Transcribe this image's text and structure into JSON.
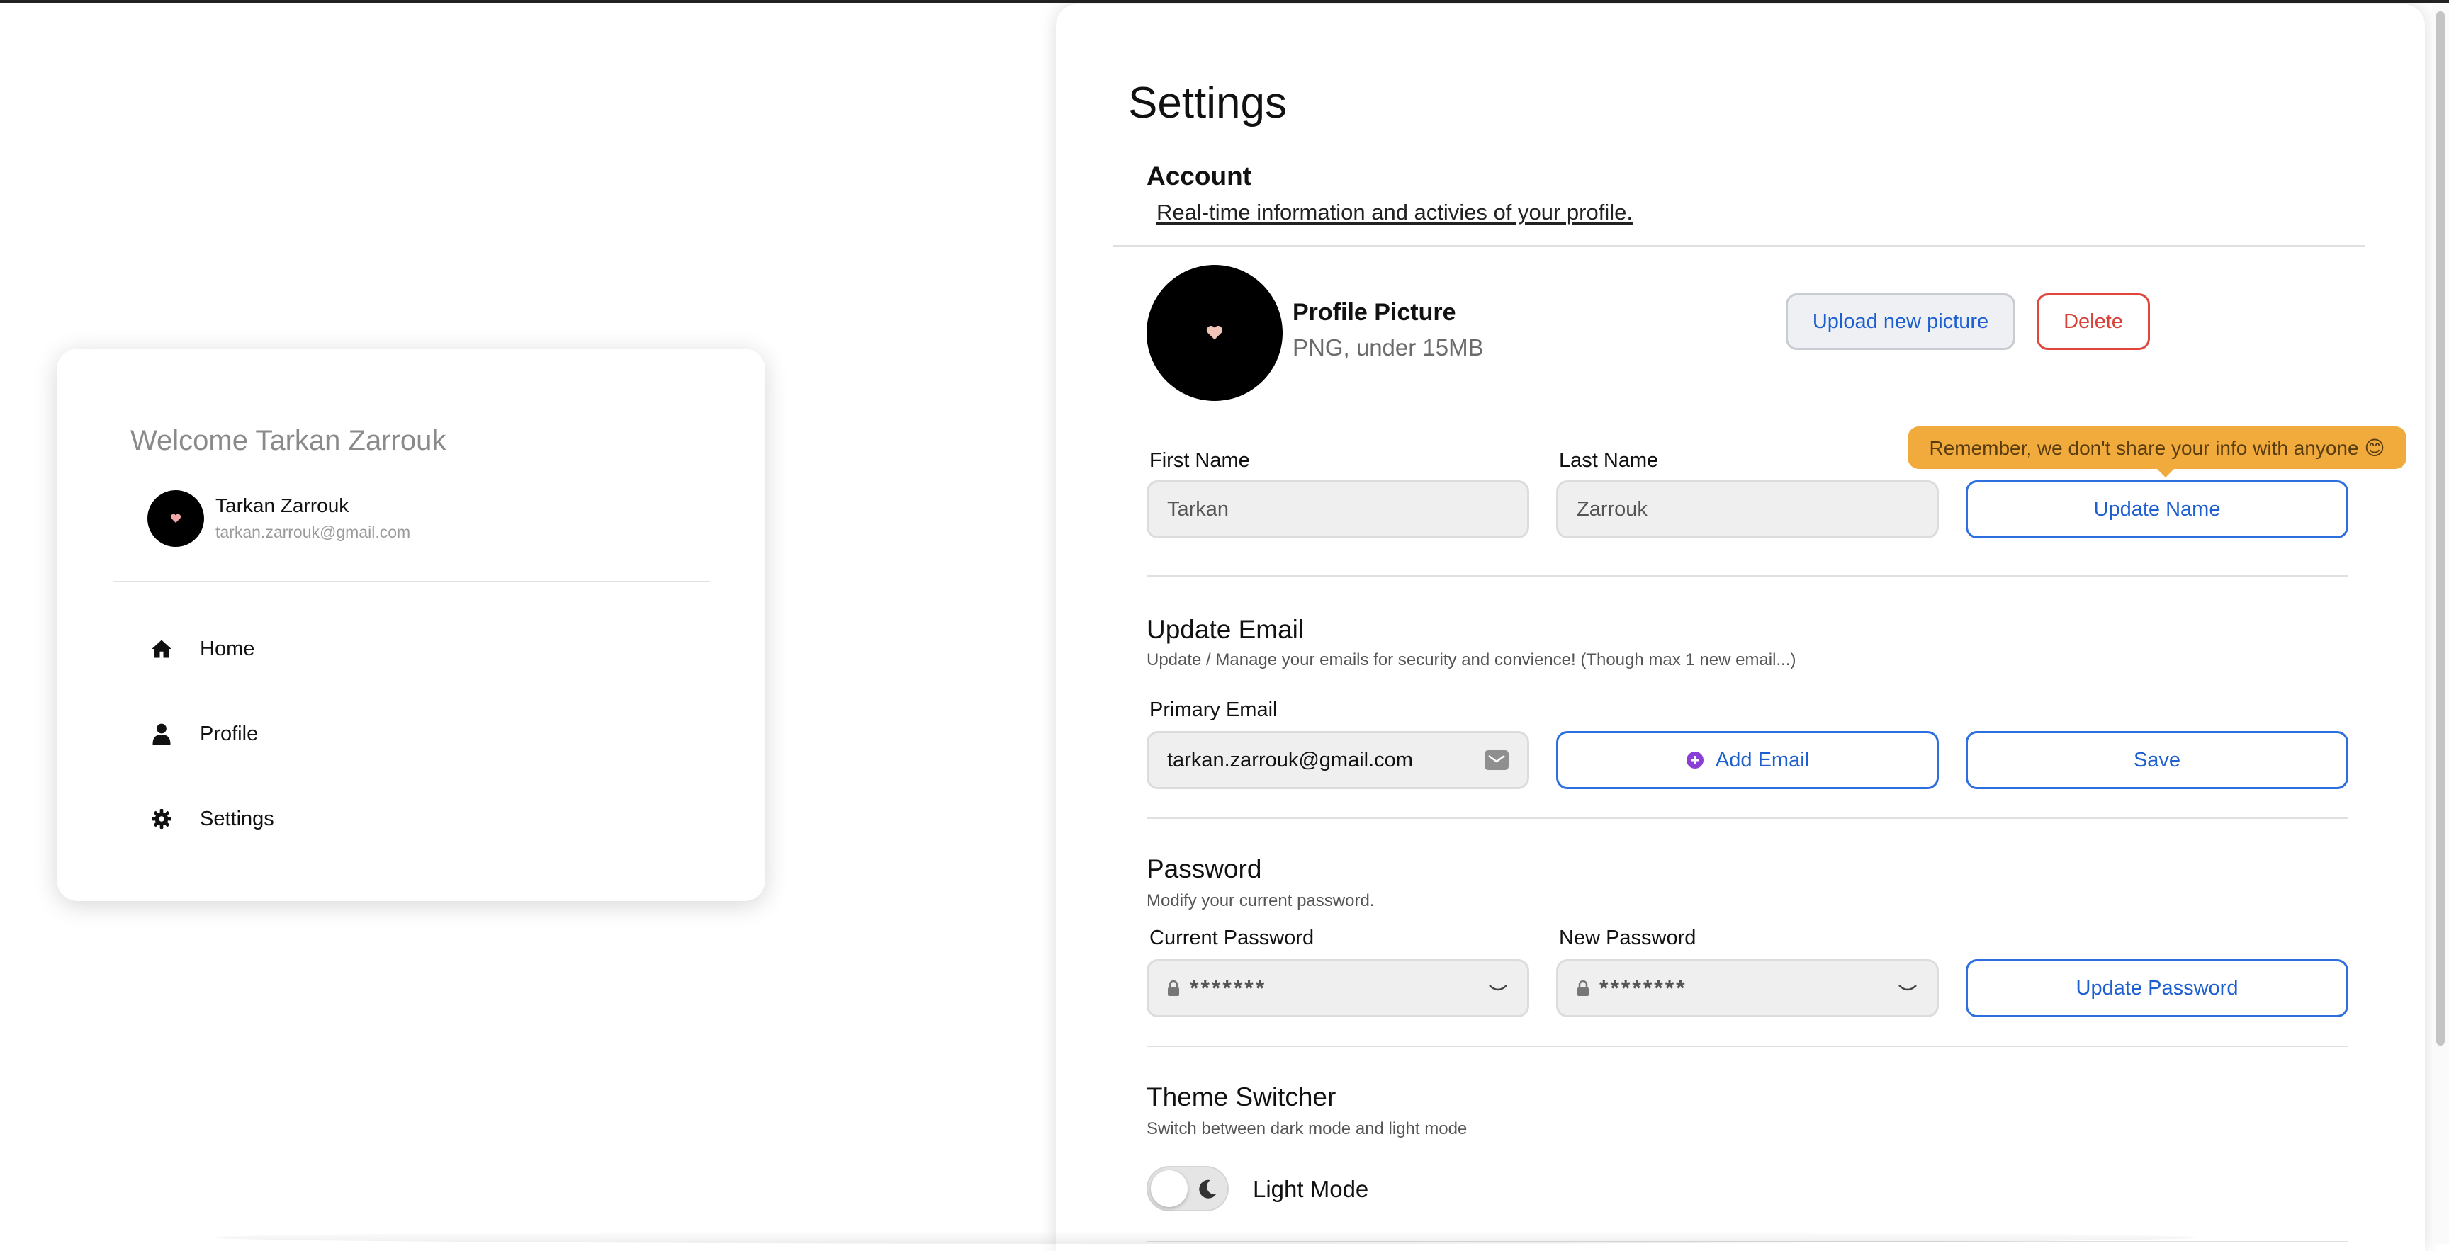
{
  "sidebar": {
    "welcome": "Welcome Tarkan Zarrouk",
    "user_name": "Tarkan Zarrouk",
    "user_email": "tarkan.zarrouk@gmail.com",
    "nav": [
      {
        "label": "Home",
        "icon": "home-icon"
      },
      {
        "label": "Profile",
        "icon": "user-icon"
      },
      {
        "label": "Settings",
        "icon": "gear-icon"
      }
    ]
  },
  "settings": {
    "title": "Settings",
    "account": {
      "title": "Account",
      "subtitle": "Real-time information and activies of your profile."
    },
    "profile_picture": {
      "title": "Profile Picture",
      "subtitle": "PNG, under 15MB",
      "upload_label": "Upload new picture",
      "delete_label": "Delete"
    },
    "name": {
      "tooltip": "Remember, we don't share your info with anyone 😊",
      "first_label": "First Name",
      "first_value": "Tarkan",
      "last_label": "Last Name",
      "last_value": "Zarrouk",
      "update_label": "Update Name"
    },
    "email": {
      "title": "Update Email",
      "subtitle": "Update / Manage your emails for security and convience! (Though max 1 new email...)",
      "primary_label": "Primary Email",
      "primary_value": "tarkan.zarrouk@gmail.com",
      "add_label": "Add Email",
      "save_label": "Save"
    },
    "password": {
      "title": "Password",
      "subtitle": "Modify your current password.",
      "current_label": "Current Password",
      "current_value": "*******",
      "new_label": "New Password",
      "new_value": "********",
      "update_label": "Update Password"
    },
    "theme": {
      "title": "Theme Switcher",
      "subtitle": "Switch between dark mode and light mode",
      "mode_label": "Light Mode"
    }
  },
  "colors": {
    "accent": "#1d5fd0",
    "danger": "#d6423a",
    "tooltip": "#f0ab3c"
  }
}
